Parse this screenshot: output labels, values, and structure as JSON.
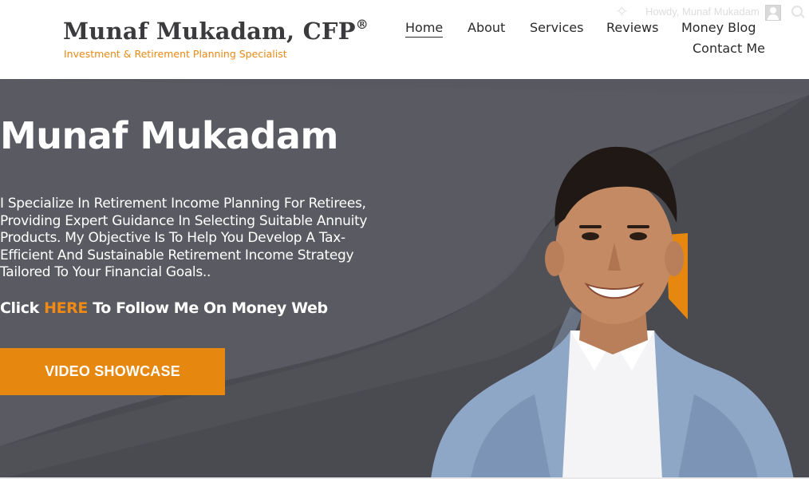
{
  "brand": {
    "name": "Munaf Mukadam, CFP",
    "reg_mark": "®",
    "tagline": "Investment & Retirement Planning Specialist"
  },
  "admin_bar": {
    "greeting": "Howdy, Munaf Mukadam",
    "icons": [
      "sparkle-icon",
      "avatar",
      "search-icon"
    ]
  },
  "nav": {
    "items": [
      {
        "label": "Home",
        "active": true
      },
      {
        "label": "About",
        "active": false
      },
      {
        "label": "Services",
        "active": false
      },
      {
        "label": "Reviews",
        "active": false
      },
      {
        "label": "Money Blog",
        "active": false
      },
      {
        "label": "Contact Me",
        "active": false
      }
    ]
  },
  "hero": {
    "title": "Munaf Mukadam",
    "description": "I Specialize In Retirement Income Planning For Retirees, Providing Expert Guidance In Selecting Suitable Annuity Products. My Objective Is To Help You Develop A Tax-Efficient And Sustainable Retirement Income Strategy Tailored To Your Financial Goals..",
    "follow_prefix": "Click ",
    "follow_link": "HERE",
    "follow_suffix": " To Follow Me On Money Web",
    "button_label": "VIDEO SHOWCASE"
  },
  "colors": {
    "accent": "#e6870f",
    "hero_bg": "#4a4a51",
    "text_dark": "#2a2a2a"
  }
}
